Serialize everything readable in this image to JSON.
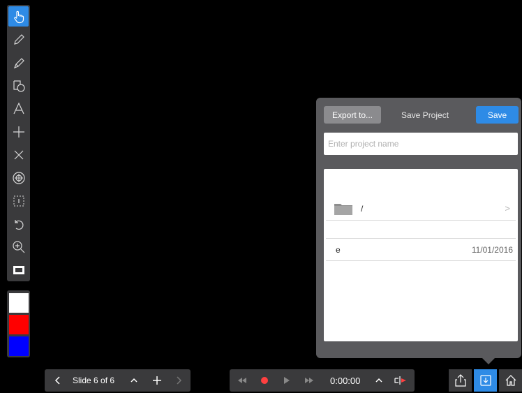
{
  "toolbar": {
    "tools": [
      {
        "icon": "hand-pointer-icon",
        "active": true
      },
      {
        "icon": "pen-icon"
      },
      {
        "icon": "highlighter-icon"
      },
      {
        "icon": "shapes-icon"
      },
      {
        "icon": "text-icon",
        "glyph": "A"
      },
      {
        "icon": "plus-icon"
      },
      {
        "icon": "cross-icon"
      },
      {
        "icon": "target-icon"
      },
      {
        "icon": "selection-icon"
      },
      {
        "icon": "undo-icon"
      },
      {
        "icon": "zoom-icon"
      },
      {
        "icon": "screen-icon"
      }
    ],
    "swatches": [
      "#ffffff",
      "#ff0000",
      "#0000ff"
    ]
  },
  "panel": {
    "export_label": "Export to...",
    "title": "Save Project",
    "save_label": "Save",
    "name_placeholder": "Enter project name",
    "folder": {
      "name": "/"
    },
    "files": [
      {
        "name": "e",
        "date": "11/01/2016"
      }
    ]
  },
  "bottom": {
    "slide_label": "Slide 6 of 6",
    "time": "0:00:00"
  },
  "colors": {
    "accent": "#2e8be6",
    "record": "#ff4040"
  }
}
